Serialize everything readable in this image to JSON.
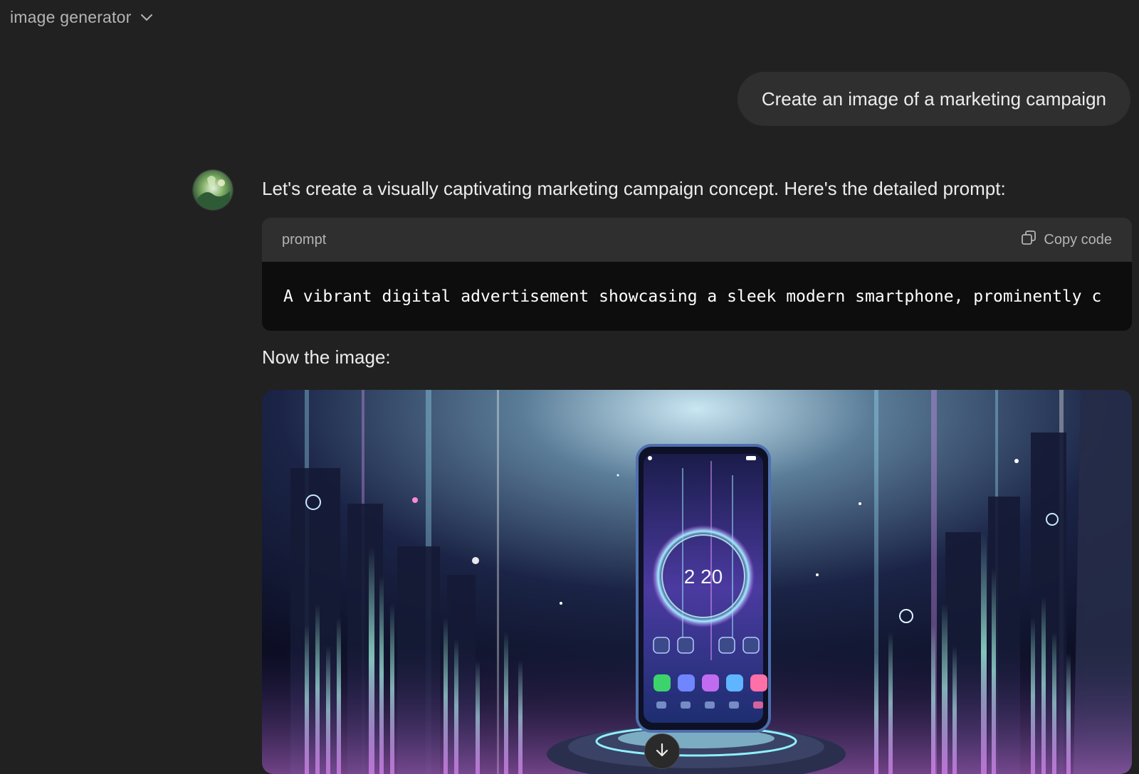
{
  "header": {
    "title": "image generator",
    "dropdown_icon": "chevron-down-icon"
  },
  "conversation": {
    "user_message": "Create an image of a marketing campaign",
    "assistant": {
      "avatar_icon": "gpt-avatar-landscape",
      "intro_text": "Let's create a visually captivating marketing campaign concept. Here's the detailed prompt:",
      "code_block": {
        "language_label": "prompt",
        "copy_label": "Copy code",
        "copy_icon": "copy-icon",
        "code_text": "A vibrant digital advertisement showcasing a sleek modern smartphone, prominently c"
      },
      "image_intro": "Now the image:",
      "image": {
        "description_icon": "generated-image",
        "phone_clock": "2 20",
        "download_icon": "arrow-down-icon"
      }
    }
  },
  "colors": {
    "background": "#212121",
    "bubble": "#2f2f2f",
    "code_bg": "#0d0d0d",
    "muted_text": "#b4b4b4",
    "text": "#ececec"
  }
}
